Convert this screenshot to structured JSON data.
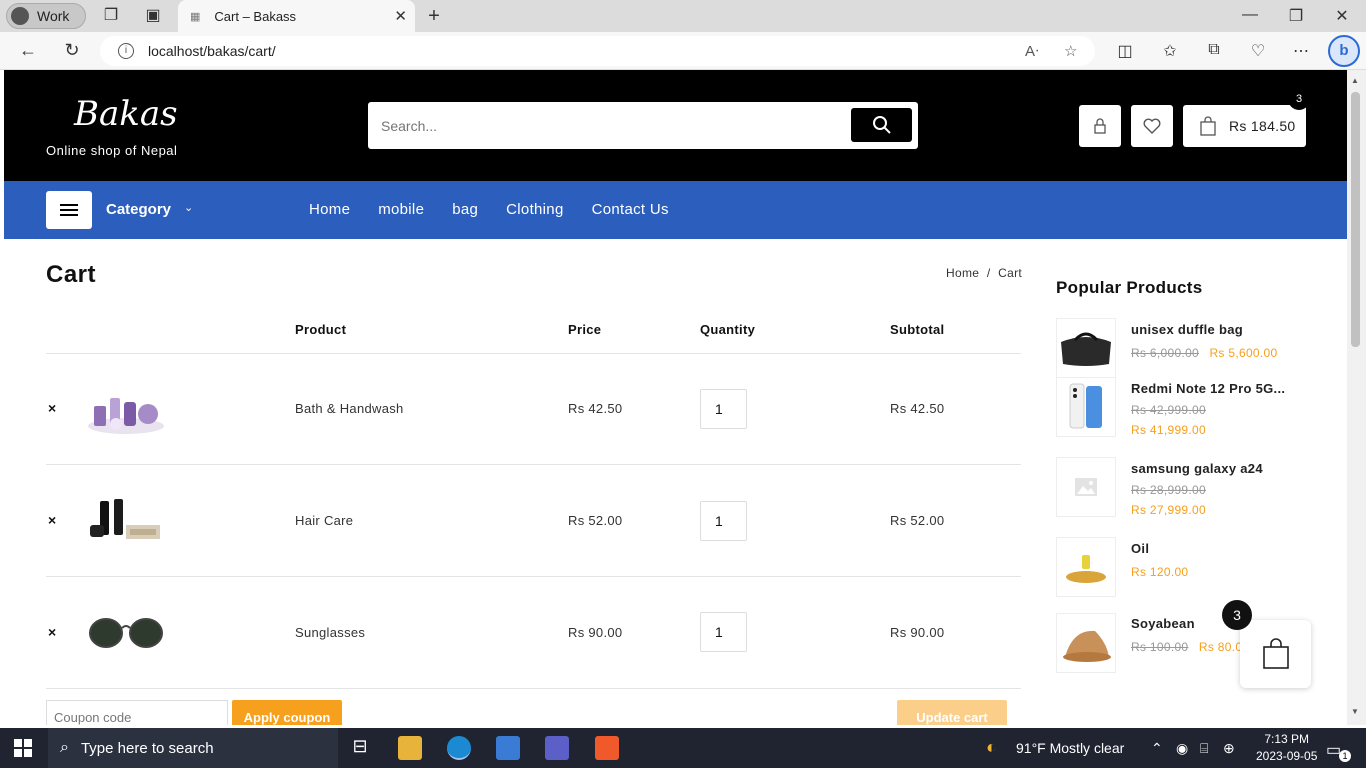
{
  "browser": {
    "profile": "Work",
    "tab_title": "Cart – Bakass",
    "url": "localhost/bakas/cart/"
  },
  "site": {
    "logo": "Bakas",
    "tagline": "Online shop of Nepal",
    "search_placeholder": "Search...",
    "cart_total": "Rs 184.50",
    "cart_count": "3"
  },
  "nav": {
    "category": "Category",
    "items": [
      "Home",
      "mobile",
      "bag",
      "Clothing",
      "Contact Us"
    ]
  },
  "cart": {
    "title": "Cart",
    "breadcrumb_home": "Home",
    "breadcrumb_sep": "/",
    "breadcrumb_current": "Cart",
    "headers": {
      "product": "Product",
      "price": "Price",
      "quantity": "Quantity",
      "subtotal": "Subtotal"
    },
    "rows": [
      {
        "remove": "×",
        "name": "Bath & Handwash",
        "price": "Rs 42.50",
        "qty": "1",
        "subtotal": "Rs 42.50"
      },
      {
        "remove": "×",
        "name": "Hair Care",
        "price": "Rs 52.00",
        "qty": "1",
        "subtotal": "Rs 52.00"
      },
      {
        "remove": "×",
        "name": "Sunglasses",
        "price": "Rs 90.00",
        "qty": "1",
        "subtotal": "Rs 90.00"
      }
    ],
    "coupon_placeholder": "Coupon code",
    "apply_label": "Apply coupon",
    "update_label": "Update cart"
  },
  "popular": {
    "title": "Popular Products",
    "items": [
      {
        "name": "unisex duffle bag",
        "old": "Rs 6,000.00",
        "new": "Rs 5,600.00"
      },
      {
        "name": "Redmi Note 12 Pro 5G...",
        "old": "Rs 42,999.00",
        "new": "Rs 41,999.00"
      },
      {
        "name": "samsung galaxy a24",
        "old": "Rs 28,999.00",
        "new": "Rs 27,999.00"
      },
      {
        "name": "Oil",
        "old": "",
        "new": "Rs 120.00"
      },
      {
        "name": "Soyabean",
        "old": "Rs 100.00",
        "new": "Rs 80.0"
      }
    ]
  },
  "floating_cart_count": "3",
  "taskbar": {
    "search_text": "Type here to search",
    "weather": "91°F  Mostly clear",
    "time": "7:13 PM",
    "date": "2023-09-05",
    "notif_count": "1"
  },
  "colors": {
    "header_bg": "#000000",
    "nav_bg": "#2c5fbd",
    "accent": "#f7a01d"
  }
}
